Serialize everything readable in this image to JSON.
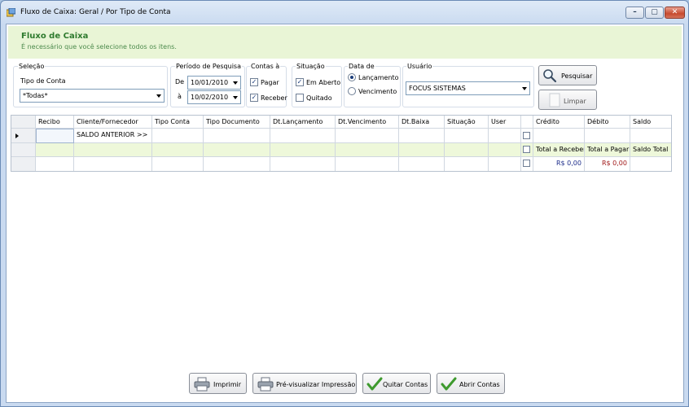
{
  "window": {
    "title": "Fluxo de Caixa: Geral / Por Tipo de Conta",
    "min_glyph": "–",
    "max_glyph": "▢",
    "close_glyph": "✕"
  },
  "header": {
    "title": "Fluxo de Caixa",
    "subtitle": "É necessário que você selecione todos os itens."
  },
  "selecao": {
    "group_label": "Seleção",
    "tipo_label": "Tipo de Conta",
    "tipo_value": "*Todas*"
  },
  "periodo": {
    "group_label": "Período de Pesquisa",
    "de_label": "De",
    "de_value": "10/01/2010",
    "a_label": "à",
    "a_value": "10/02/2010"
  },
  "contas": {
    "group_label": "Contas à",
    "pagar_label": "Pagar",
    "pagar_checked": "✓",
    "receber_label": "Receber",
    "receber_checked": "✓"
  },
  "situacao": {
    "group_label": "Situação",
    "aberto_label": "Em Aberto",
    "aberto_checked": "✓",
    "quitado_label": "Quitado"
  },
  "data_de": {
    "group_label": "Data de",
    "lancamento_label": "Lançamento",
    "vencimento_label": "Vencimento",
    "selected": "lancamento"
  },
  "usuario": {
    "group_label": "Usuário",
    "value": "FOCUS SISTEMAS"
  },
  "actions": {
    "pesquisar": "Pesquisar",
    "limpar": "Limpar"
  },
  "grid": {
    "columns": [
      "Recibo",
      "Cliente/Fornecedor",
      "Tipo Conta",
      "Tipo Documento",
      "Dt.Lançamento",
      "Dt.Vencimento",
      "Dt.Baixa",
      "Situação",
      "User",
      "",
      "Crédito",
      "Débito",
      "Saldo"
    ],
    "row1_cliente": "SALDO ANTERIOR >>",
    "total_receber_label": "Total a Receber",
    "total_pagar_label": "Total a Pagar",
    "saldo_total_label": "Saldo Total",
    "credito_total": "R$ 0,00",
    "debito_total": "R$ 0,00"
  },
  "footer": {
    "imprimir": "Imprimir",
    "previsualizar": "Pré-visualizar Impressão",
    "quitar": "Quitar Contas",
    "abrir": "Abrir Contas"
  },
  "colors": {
    "header_bg": "#e9f5d6",
    "header_title": "#2e7a2e",
    "credit": "#1c2c8a",
    "debit": "#a01818"
  }
}
